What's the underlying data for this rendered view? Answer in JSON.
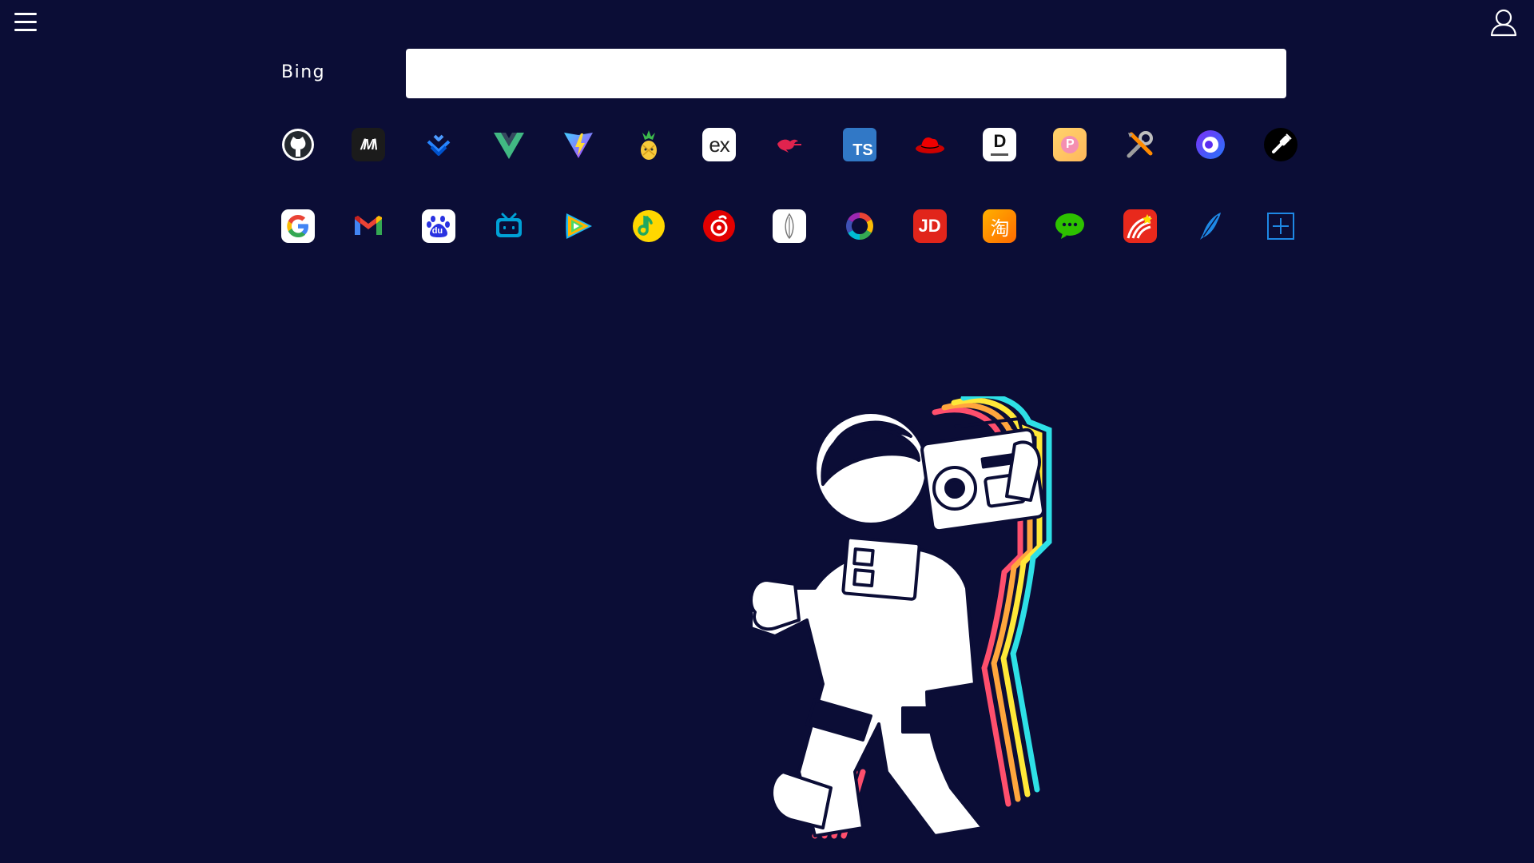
{
  "header": {
    "menu_icon": "hamburger-menu-icon",
    "user_icon": "user-icon"
  },
  "search": {
    "engine_label": "Bing",
    "value": "",
    "placeholder": ""
  },
  "shortcuts": {
    "row1": [
      {
        "name": "github",
        "icon": "github-icon"
      },
      {
        "name": "mdn",
        "icon": "mdn-icon",
        "text": "/M\\"
      },
      {
        "name": "jira",
        "icon": "jira-icon"
      },
      {
        "name": "vue",
        "icon": "vue-icon"
      },
      {
        "name": "vite",
        "icon": "vite-icon"
      },
      {
        "name": "pineapple",
        "icon": "pineapple-icon"
      },
      {
        "name": "express",
        "icon": "express-icon",
        "text": "ex"
      },
      {
        "name": "nest",
        "icon": "nest-icon"
      },
      {
        "name": "typescript",
        "icon": "typescript-icon",
        "text": "TS"
      },
      {
        "name": "redhat",
        "icon": "redhat-icon"
      },
      {
        "name": "dict",
        "icon": "dict-icon",
        "text": "D"
      },
      {
        "name": "p-app",
        "icon": "p-app-icon",
        "text": "P"
      },
      {
        "name": "tools",
        "icon": "tools-icon"
      },
      {
        "name": "circle-app",
        "icon": "circle-app-icon"
      },
      {
        "name": "plugin",
        "icon": "plugin-icon"
      }
    ],
    "row2": [
      {
        "name": "google",
        "icon": "google-icon"
      },
      {
        "name": "gmail",
        "icon": "gmail-icon"
      },
      {
        "name": "baidu",
        "icon": "baidu-icon",
        "text": "du"
      },
      {
        "name": "bilibili",
        "icon": "bilibili-icon"
      },
      {
        "name": "tencent-video",
        "icon": "tencent-video-icon"
      },
      {
        "name": "qq-music",
        "icon": "qq-music-icon"
      },
      {
        "name": "netease-music",
        "icon": "netease-music-icon"
      },
      {
        "name": "feather-app",
        "icon": "feather-app-icon"
      },
      {
        "name": "colorful-ring",
        "icon": "colorful-ring-icon"
      },
      {
        "name": "jd",
        "icon": "jd-icon",
        "text": "JD"
      },
      {
        "name": "taobao",
        "icon": "taobao-icon",
        "text": "淘"
      },
      {
        "name": "wechat",
        "icon": "wechat-icon"
      },
      {
        "name": "xuexitong",
        "icon": "xuexitong-icon"
      },
      {
        "name": "quill",
        "icon": "quill-icon"
      },
      {
        "name": "add-shortcut",
        "icon": "add-shortcut-icon"
      }
    ]
  },
  "colors": {
    "background": "#0b0d36",
    "search_bg": "#ffffff",
    "accent_blue": "#1e88e5"
  },
  "illustration": {
    "icon": "astronaut-with-boombox-illustration"
  }
}
